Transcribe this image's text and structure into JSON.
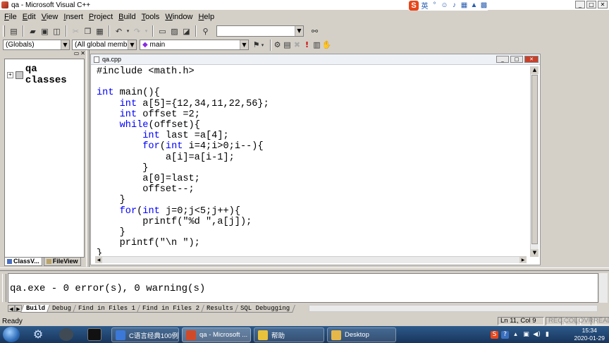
{
  "window": {
    "title": "qa - Microsoft Visual C++"
  },
  "ime": {
    "lang_label": "英"
  },
  "menu": [
    "File",
    "Edit",
    "View",
    "Insert",
    "Project",
    "Build",
    "Tools",
    "Window",
    "Help"
  ],
  "wizard_bar": {
    "scope": "(Globals)",
    "members": "(All global members",
    "function": "main"
  },
  "class_view": {
    "root": "qa classes",
    "tabs": [
      "ClassV...",
      "FileView"
    ]
  },
  "editor": {
    "filename": "qa.cpp",
    "code_lines": [
      "#include <math.h>",
      "",
      "int main(){",
      "    int a[5]={12,34,11,22,56};",
      "    int offset =2;",
      "    while(offset){",
      "        int last =a[4];",
      "        for(int i=4;i>0;i--){",
      "            a[i]=a[i-1];",
      "        }",
      "        a[0]=last;",
      "        offset--;",
      "    }",
      "    for(int j=0;j<5;j++){",
      "        printf(\"%d \",a[j]);",
      "    }",
      "    printf(\"\\n \");",
      "}"
    ],
    "keywords": [
      "int",
      "while",
      "for"
    ]
  },
  "output": {
    "text": "qa.exe - 0 error(s), 0 warning(s)",
    "tabs": [
      "Build",
      "Debug",
      "Find in Files 1",
      "Find in Files 2",
      "Results",
      "SQL Debugging"
    ]
  },
  "status": {
    "message": "Ready",
    "position": "Ln 11, Col 9",
    "indicators": [
      "REC",
      "COL",
      "OVR",
      "READ"
    ]
  },
  "taskbar": {
    "items": [
      {
        "label": "C语言经典100例...",
        "color": "#3b78d8"
      },
      {
        "label": "qa - Microsoft ...",
        "color": "#d04a2a"
      },
      {
        "label": "帮助",
        "color": "#e8c23a"
      },
      {
        "label": "Desktop",
        "color": "#e6b84a"
      }
    ],
    "time": "15:34",
    "date": "2020-01-29"
  },
  "colors": {
    "keyword": "#0000ff",
    "chrome": "#d4d0c8",
    "taskbar": "#1f416b"
  }
}
